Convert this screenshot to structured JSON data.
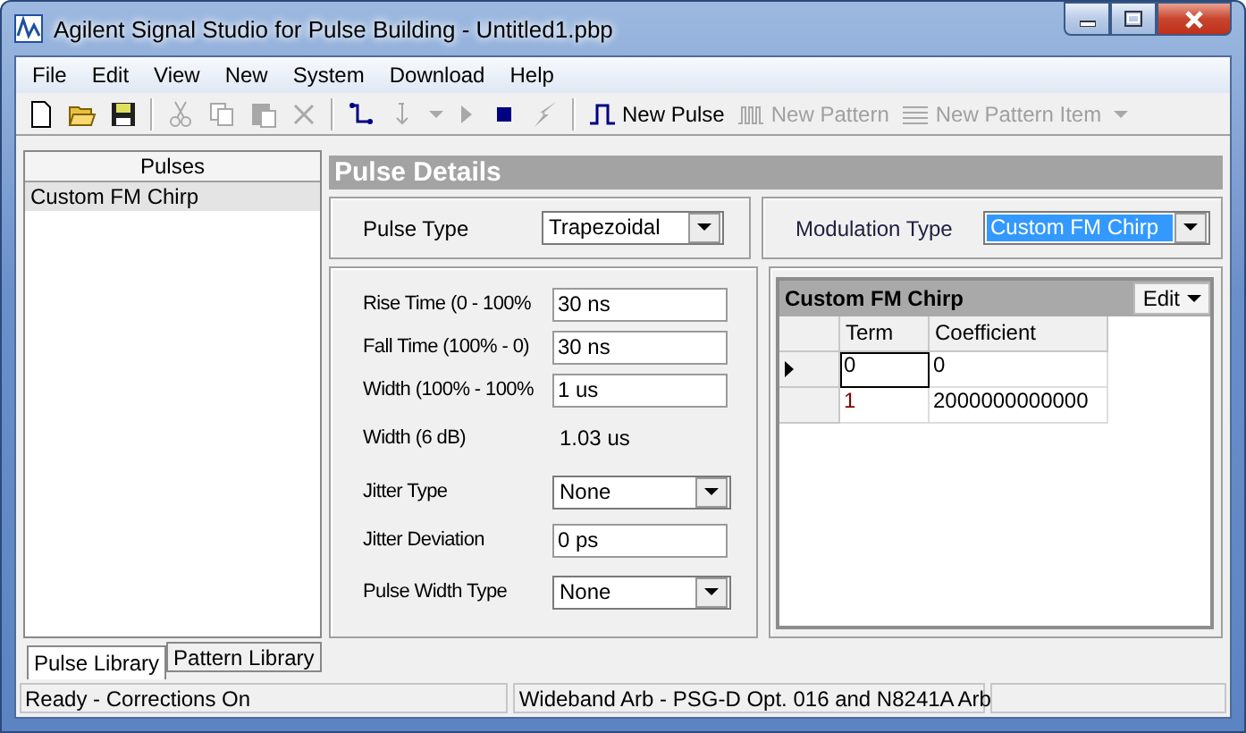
{
  "window": {
    "title": "Agilent Signal Studio for Pulse Building - Untitled1.pbp"
  },
  "menu": [
    {
      "label": "File"
    },
    {
      "label": "Edit"
    },
    {
      "label": "View"
    },
    {
      "label": "New"
    },
    {
      "label": "System"
    },
    {
      "label": "Download"
    },
    {
      "label": "Help"
    }
  ],
  "toolbar": [
    [
      {
        "disabled": false
      },
      {
        "disabled": false
      },
      {
        "disabled": false
      }
    ],
    [
      {
        "disabled": true
      },
      {
        "disabled": true
      },
      {
        "disabled": true
      },
      {
        "disabled": true
      }
    ],
    [
      {
        "disabled": false
      },
      {
        "disabled": true
      },
      {
        "disabled": true
      },
      {
        "disabled": true
      },
      {
        "disabled": false
      },
      {
        "disabled": true
      }
    ],
    [
      {
        "label": "New Pulse",
        "disabled": false
      },
      {
        "label": "New Pattern",
        "disabled": true
      },
      {
        "label": "New Pattern Item",
        "disabled": true
      },
      {
        "disabled": true
      }
    ]
  ],
  "pulses": {
    "header": "Pulses",
    "items": [
      {
        "label": "Custom FM Chirp",
        "selected": true
      }
    ]
  },
  "pulse_details": {
    "title": "Pulse Details",
    "pulse_type": {
      "label": "Pulse Type",
      "value": "Trapezoidal"
    },
    "modulation_type": {
      "label": "Modulation Type",
      "value": "Custom FM Chirp",
      "focused": true
    },
    "fields": [
      {
        "kind": "text",
        "label": "Rise Time (0 - 100%",
        "value": "30 ns"
      },
      {
        "kind": "text",
        "label": "Fall Time (100% - 0)",
        "value": "30 ns"
      },
      {
        "kind": "text",
        "label": "Width (100% - 100%",
        "value": "1 us"
      },
      {
        "kind": "readout",
        "label": "Width (6 dB)",
        "value": "1.03 us"
      },
      {
        "kind": "dropdown",
        "label": "Jitter Type",
        "value": "None"
      },
      {
        "kind": "text",
        "label": "Jitter Deviation",
        "value": "0 ps"
      },
      {
        "kind": "dropdown",
        "label": "Pulse Width Type",
        "value": "None"
      }
    ],
    "grid": {
      "title": "Custom FM Chirp",
      "edit_button": "Edit",
      "columns": [
        "Term",
        "Coefficient"
      ],
      "rows": [
        {
          "term": "0",
          "coefficient": "0",
          "current": true
        },
        {
          "term": "1",
          "coefficient": "2000000000000",
          "current": false
        }
      ]
    }
  },
  "library_tabs": [
    {
      "label": "Pulse Library",
      "selected": true
    },
    {
      "label": "Pattern Library",
      "selected": false
    }
  ],
  "status_bar": [
    "Ready - Corrections On",
    "Wideband Arb - PSG-D Opt. 016 and N8241A Arb"
  ]
}
